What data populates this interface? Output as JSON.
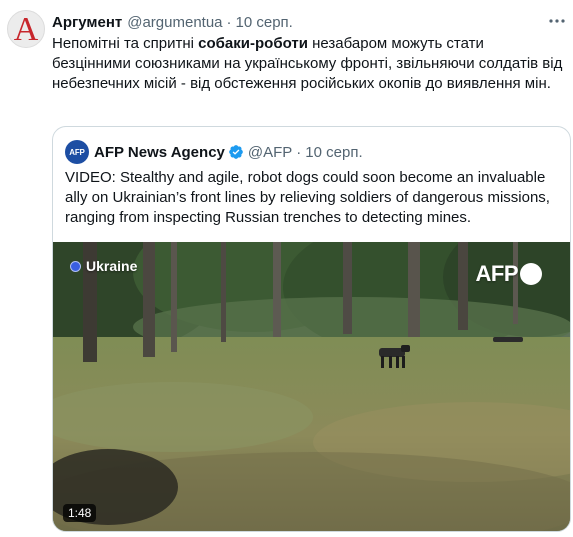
{
  "tweet": {
    "avatar_letter": "A",
    "author_name": "Аргумент",
    "handle": "@argumentua",
    "separator": "·",
    "date": "10 серп.",
    "more_icon": "more-dots-icon",
    "text_part1": "Непомітні та спритні ",
    "text_bold": "собаки-роботи",
    "text_part2": " незабаром можуть стати безцінними союзниками на українському фронті, звільняючи солдатів від небезпечних місій - від обстеження російських окопів до виявлення мін."
  },
  "quote": {
    "avatar_text": "AFP",
    "author_name": "AFP News Agency",
    "verified_icon": "verified-badge-icon",
    "handle": "@AFP",
    "separator": "·",
    "date": "10 серп.",
    "text": "VIDEO: Stealthy and agile, robot dogs could soon become an invaluable ally on Ukrainian’s front lines by relieving soldiers of dangerous missions, ranging from inspecting Russian trenches to detecting mines.",
    "media": {
      "location_label": "Ukraine",
      "watermark": "AFP",
      "duration": "1:48"
    }
  },
  "colors": {
    "text": "#0f1419",
    "secondary": "#536471",
    "verified": "#1d9bf0",
    "border": "#cfd9de",
    "avatar_red": "#c7262c",
    "afp_blue": "#1d4ea3"
  }
}
